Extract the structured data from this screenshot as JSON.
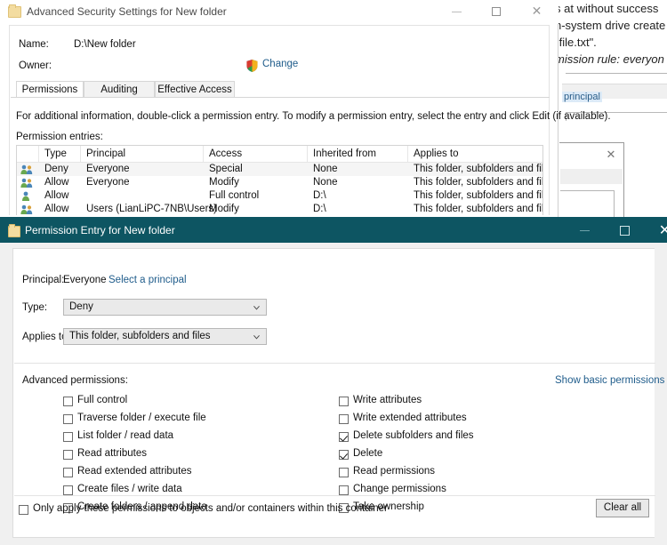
{
  "background": {
    "lines": [
      "s at without success",
      "n-system drive create",
      "\"file.txt\".",
      "mission rule: everyon"
    ],
    "link_fragment": "principal"
  },
  "advanced_window": {
    "title": "Advanced Security Settings for New folder",
    "icon": "folder-icon",
    "controls": {
      "minimize": "minimize-icon",
      "maximize": "maximize-icon",
      "close": "close-icon"
    },
    "name_label": "Name:",
    "name_value": "D:\\New folder",
    "owner_label": "Owner:",
    "owner_value": "",
    "change_link": "Change",
    "change_icon": "shield-icon",
    "tabs": [
      {
        "label": "Permissions",
        "selected": true
      },
      {
        "label": "Auditing",
        "selected": false
      },
      {
        "label": "Effective Access",
        "selected": false
      }
    ],
    "info_text": "For additional information, double-click a permission entry. To modify a permission entry, select the entry and click Edit (if available).",
    "entries_label": "Permission entries:",
    "grid": {
      "columns": [
        "Type",
        "Principal",
        "Access",
        "Inherited from",
        "Applies to"
      ],
      "rows": [
        {
          "icon": "group-icon",
          "type": "Deny",
          "principal": "Everyone",
          "access": "Special",
          "inherited_from": "None",
          "applies_to": "This folder, subfolders and files"
        },
        {
          "icon": "group-icon",
          "type": "Allow",
          "principal": "Everyone",
          "access": "Modify",
          "inherited_from": "None",
          "applies_to": "This folder, subfolders and files"
        },
        {
          "icon": "user-icon",
          "type": "Allow",
          "principal": "",
          "access": "Full control",
          "inherited_from": "D:\\",
          "applies_to": "This folder, subfolders and files"
        },
        {
          "icon": "group-icon",
          "type": "Allow",
          "principal": "Users (LianLiPC-7NB\\Users)",
          "access": "Modify",
          "inherited_from": "D:\\",
          "applies_to": "This folder, subfolders and files"
        }
      ]
    }
  },
  "permission_entry": {
    "title": "Permission Entry for New folder",
    "icon": "folder-icon",
    "title_bar_color": "#0d5562",
    "controls": {
      "minimize": "minimize-icon",
      "maximize": "maximize-icon",
      "close": "close-icon"
    },
    "principal_label": "Principal:",
    "principal_value": "Everyone",
    "select_principal_link": "Select a principal",
    "type_label": "Type:",
    "type_value": "Deny",
    "applies_to_label": "Applies to:",
    "applies_to_value": "This folder, subfolders and files",
    "advanced_permissions_label": "Advanced permissions:",
    "show_basic_link": "Show basic permissions",
    "permissions_left": [
      {
        "label": "Full control",
        "checked": false
      },
      {
        "label": "Traverse folder / execute file",
        "checked": false
      },
      {
        "label": "List folder / read data",
        "checked": false
      },
      {
        "label": "Read attributes",
        "checked": false
      },
      {
        "label": "Read extended attributes",
        "checked": false
      },
      {
        "label": "Create files / write data",
        "checked": false
      },
      {
        "label": "Create folders / append data",
        "checked": false
      }
    ],
    "permissions_right": [
      {
        "label": "Write attributes",
        "checked": false
      },
      {
        "label": "Write extended attributes",
        "checked": false
      },
      {
        "label": "Delete subfolders and files",
        "checked": true
      },
      {
        "label": "Delete",
        "checked": true
      },
      {
        "label": "Read permissions",
        "checked": false
      },
      {
        "label": "Change permissions",
        "checked": false
      },
      {
        "label": "Take ownership",
        "checked": false
      }
    ],
    "only_apply_label": "Only apply these permissions to objects and/or containers within this container",
    "only_apply_checked": false,
    "clear_all_label": "Clear all"
  }
}
